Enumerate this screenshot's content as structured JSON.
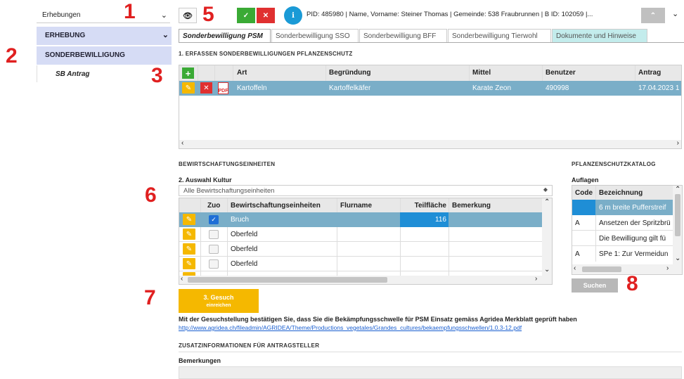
{
  "topbar": {
    "select_value": "Erhebungen",
    "info_text": "PID: 485980 | Name, Vorname: Steiner Thomas | Gemeinde: 538 Fraubrunnen | B ID: 102059 |..."
  },
  "sidebar": {
    "items": [
      {
        "label": "ERHEBUNG"
      },
      {
        "label": "SONDERBEWILLIGUNG"
      },
      {
        "label": "SB Antrag"
      }
    ]
  },
  "tabs": [
    {
      "label": "Sonderbewilligung PSM"
    },
    {
      "label": "Sonderbewilligung SSO"
    },
    {
      "label": "Sonderbewilligung BFF"
    },
    {
      "label": "Sonderbewilligung Tierwohl"
    },
    {
      "label": "Dokumente und Hinweise"
    }
  ],
  "section1": {
    "title": "1. ERFASSEN SONDERBEWILLIGUNGEN PFLANZENSCHUTZ",
    "columns": [
      "Art",
      "Begründung",
      "Mittel",
      "Benutzer",
      "Antrag"
    ],
    "rows": [
      {
        "art": "Kartoffeln",
        "begruendung": "Kartoffelkäfer",
        "mittel": "Karate Zeon",
        "benutzer": "490998",
        "antrag": "17.04.2023 1"
      }
    ]
  },
  "section2": {
    "heading": "BEWIRTSCHAFTUNGSEINHEITEN",
    "subtitle": "2. Auswahl Kultur",
    "filter_value": "Alle Bewirtschaftungseinheiten",
    "columns": [
      "Zuo",
      "Bewirtschaftungseinheiten",
      "Flurname",
      "Teilfläche",
      "Bemerkung"
    ],
    "rows": [
      {
        "name": "Bruch",
        "flurname": "",
        "teilflaeche": "116",
        "checked": true
      },
      {
        "name": "Oberfeld",
        "flurname": "",
        "teilflaeche": "",
        "checked": false
      },
      {
        "name": "Oberfeld",
        "flurname": "",
        "teilflaeche": "",
        "checked": false
      },
      {
        "name": "Oberfeld",
        "flurname": "",
        "teilflaeche": "",
        "checked": false
      }
    ]
  },
  "catalog": {
    "heading": "PFLANZENSCHUTZKATALOG",
    "subtitle": "Auflagen",
    "columns": [
      "Code",
      "Bezeichnung"
    ],
    "rows": [
      {
        "code": "",
        "text": "6 m breite Pufferstreif"
      },
      {
        "code": "A",
        "text": "Ansetzen der Spritzbrü"
      },
      {
        "code": "",
        "text": "Die Bewilligung gilt fü"
      },
      {
        "code": "A",
        "text": "SPe 1: Zur Vermeidun"
      }
    ],
    "search_label": "Suchen"
  },
  "submit": {
    "label_line1": "3. Gesuch",
    "label_line2": "einreichen"
  },
  "confirm_text": "Mit der Gesuchstellung bestätigen Sie, dass Sie die Bekämpfungsschwelle für PSM Einsatz gemäss Agridea Merkblatt geprüft haben",
  "link_text": "http://www.agridea.ch/fileadmin/AGRIDEA/Theme/Productions_vegetales/Grandes_cultures/bekaempfungsschwellen/1.0.3-12.pdf",
  "zusatz": {
    "heading": "ZUSATZINFORMATIONEN FÜR ANTRAGSTELLER",
    "bemerkungen_label": "Bemerkungen"
  },
  "markers": [
    "1",
    "2",
    "3",
    "5",
    "6",
    "7",
    "8"
  ],
  "colors": {
    "sidebar_bg": "#d6dcf5",
    "row_selected": "#7aaec8",
    "cell_selected": "#1f8ed6",
    "submit_bg": "#f5b800",
    "accept_green": "#3aaa35",
    "reject_red": "#e03030",
    "info_blue": "#1a9ad6",
    "marker_red": "#e02020",
    "tab_docs_bg": "#c3ecec"
  }
}
